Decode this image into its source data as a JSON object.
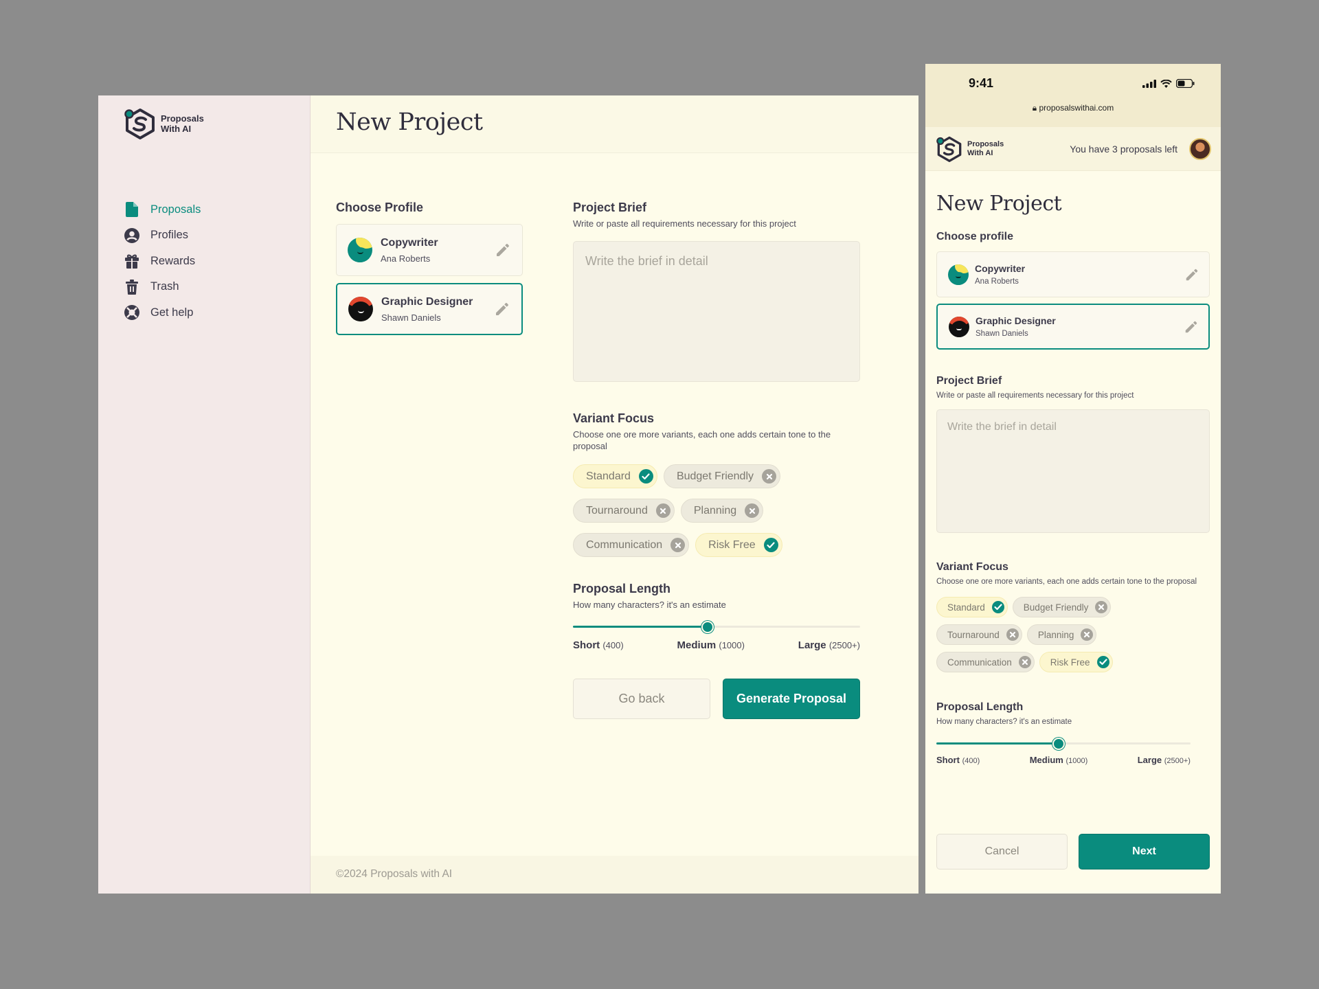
{
  "brand": {
    "line1": "Proposals",
    "line2": "With AI"
  },
  "colors": {
    "accent": "#0a8c7e",
    "sidebar_bg": "#f3e9e8",
    "main_bg": "#fefcea",
    "chip_on_bg": "#fcf6cf",
    "chip_off_bg": "#edeadd"
  },
  "sidebar": {
    "items": [
      {
        "label": "Proposals",
        "icon": "document-icon",
        "active": true
      },
      {
        "label": "Profiles",
        "icon": "user-circle-icon",
        "active": false
      },
      {
        "label": "Rewards",
        "icon": "gift-icon",
        "active": false
      },
      {
        "label": "Trash",
        "icon": "trash-icon",
        "active": false
      },
      {
        "label": "Get help",
        "icon": "lifebuoy-icon",
        "active": false
      }
    ]
  },
  "page": {
    "title": "New Project",
    "footer": "©2024 Proposals with AI"
  },
  "profile": {
    "title": "Choose Profile",
    "mobile_title": "Choose profile",
    "cards": [
      {
        "role": "Copywriter",
        "name": "Ana Roberts",
        "selected": false
      },
      {
        "role": "Graphic Designer",
        "name": "Shawn Daniels",
        "selected": true
      }
    ]
  },
  "brief": {
    "title": "Project Brief",
    "subtitle": "Write or paste all requirements necessary for this project",
    "placeholder": "Write the brief in detail"
  },
  "variant": {
    "title": "Variant Focus",
    "subtitle": "Choose one ore more variants, each one adds certain tone to the proposal",
    "chips": [
      {
        "label": "Standard",
        "selected": true
      },
      {
        "label": "Budget Friendly",
        "selected": false
      },
      {
        "label": "Tournaround",
        "selected": false
      },
      {
        "label": "Planning",
        "selected": false
      },
      {
        "label": "Communication",
        "selected": false
      },
      {
        "label": "Risk Free",
        "selected": true
      }
    ]
  },
  "length": {
    "title": "Proposal Length",
    "subtitle": "How many characters? it's an estimate",
    "value_fraction": 0.47,
    "mobile_value_fraction": 0.48,
    "ticks": [
      {
        "label": "Short",
        "count": "(400)"
      },
      {
        "label": "Medium",
        "count": "(1000)"
      },
      {
        "label": "Large",
        "count": "(2500+)"
      }
    ]
  },
  "actions": {
    "back": "Go back",
    "generate": "Generate Proposal"
  },
  "mobile": {
    "time": "9:41",
    "url": "proposalswithai.com",
    "proposals_left": "You have 3 proposals left",
    "cancel": "Cancel",
    "next": "Next"
  }
}
